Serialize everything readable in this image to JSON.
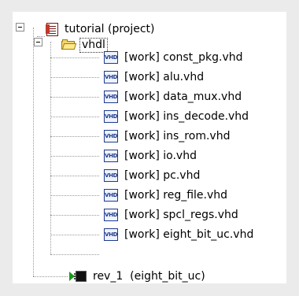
{
  "tree": {
    "project": {
      "label": "tutorial (project)",
      "icon": "project-icon"
    },
    "folder": {
      "label": "vhdl",
      "icon": "folder-open-icon"
    },
    "files": [
      "[work] const_pkg.vhd",
      "[work] alu.vhd",
      "[work] data_mux.vhd",
      "[work] ins_decode.vhd",
      "[work] ins_rom.vhd",
      "[work] io.vhd",
      "[work] pc.vhd",
      "[work] reg_file.vhd",
      "[work] spcl_regs.vhd",
      "[work] eight_bit_uc.vhd"
    ],
    "file_icon_text": "VHD",
    "revision": {
      "label": "rev_1  (eight_bit_uc)",
      "icon": "revision-chip-icon"
    }
  },
  "colors": {
    "background": "#ebebeb",
    "panel": "#ffffff",
    "tree_lines": "#9a9a9a",
    "vhd_icon": "#1f3a8a",
    "revision_arrow": "#1a9a1a"
  }
}
